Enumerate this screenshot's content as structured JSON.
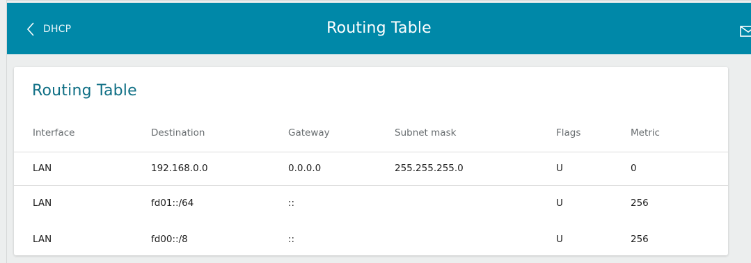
{
  "header": {
    "back_label": "DHCP",
    "title": "Routing Table"
  },
  "card": {
    "title": "Routing Table",
    "columns": [
      "Interface",
      "Destination",
      "Gateway",
      "Subnet mask",
      "Flags",
      "Metric"
    ],
    "rows": [
      [
        "LAN",
        "192.168.0.0",
        "0.0.0.0",
        "255.255.255.0",
        "U",
        "0"
      ],
      [
        "LAN",
        "fd01::/64",
        "::",
        "",
        "U",
        "256"
      ],
      [
        "LAN",
        "fd00::/8",
        "::",
        "",
        "U",
        "256"
      ]
    ]
  },
  "icons": {
    "back": "chevron-left-icon",
    "mail": "mail-icon"
  },
  "colors": {
    "header_bg": "#0088a8",
    "title_text": "#0f6f85",
    "page_bg": "#eceeee"
  }
}
